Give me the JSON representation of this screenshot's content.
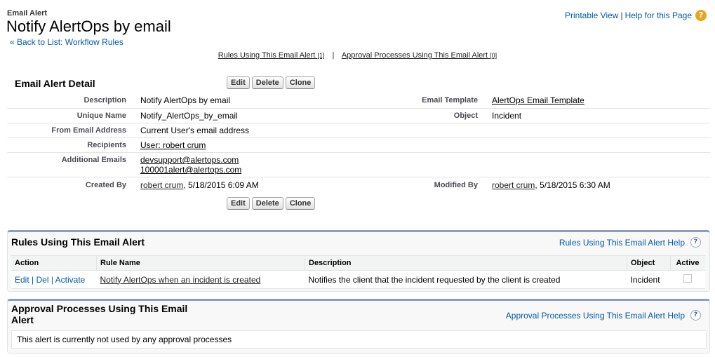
{
  "header": {
    "object_type": "Email Alert",
    "title": "Notify AlertOps by email",
    "back_link": "« Back to List: Workflow Rules",
    "printable_view": "Printable View",
    "separator": "|",
    "help_link": "Help for this Page",
    "help_icon": "?"
  },
  "related_links": {
    "rules_label": "Rules Using This Email Alert",
    "rules_count": "[1]",
    "separator": "|",
    "approvals_label": "Approval Processes Using This Email Alert",
    "approvals_count": "[0]"
  },
  "detail": {
    "title": "Email Alert Detail",
    "buttons": {
      "edit": "Edit",
      "delete": "Delete",
      "clone": "Clone"
    },
    "description_label": "Description",
    "description_value": "Notify AlertOps by email",
    "email_template_label": "Email Template",
    "email_template_value": "AlertOps Email Template",
    "unique_name_label": "Unique Name",
    "unique_name_value": "Notify_AlertOps_by_email",
    "object_label": "Object",
    "object_value": "Incident",
    "from_label": "From Email Address",
    "from_value": "Current User's email address",
    "recipients_label": "Recipients",
    "recipients_value": "User: robert crum",
    "additional_label": "Additional Emails",
    "additional_email_1": "devsupport@alertops.com",
    "additional_email_2": "100001alert@alertops.com",
    "created_label": "Created By",
    "created_user": "robert crum",
    "created_date": ", 5/18/2015 6:09 AM",
    "modified_label": "Modified By",
    "modified_user": "robert crum",
    "modified_date": ", 5/18/2015 6:30 AM"
  },
  "rules_section": {
    "title": "Rules Using This Email Alert",
    "help_link": "Rules Using This Email Alert Help",
    "help_icon": "?",
    "columns": [
      "Action",
      "Rule Name",
      "Description",
      "Object",
      "Active"
    ],
    "row": {
      "action_edit": "Edit",
      "action_del": "Del",
      "action_activate": "Activate",
      "action_sep": "|",
      "rule_name": "Notify AlertOps when an incident is created",
      "description": "Notifies the client that the incident requested by the client is created",
      "object": "Incident"
    }
  },
  "approvals_section": {
    "title_line1": "Approval Processes Using This Email",
    "title_line2": "Alert",
    "help_link": "Approval Processes Using This Email Alert Help",
    "help_icon": "?",
    "empty_message": "This alert is currently not used by any approval processes"
  }
}
